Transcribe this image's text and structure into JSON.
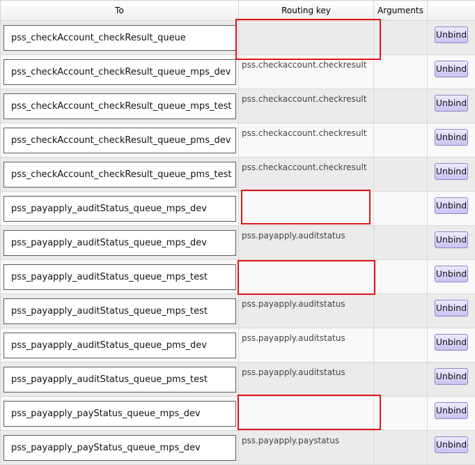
{
  "headers": {
    "to": "To",
    "routing_key": "Routing key",
    "arguments": "Arguments",
    "actions": ""
  },
  "unbind_label": "Unbind",
  "rows": [
    {
      "to": "pss_checkAccount_checkResult_queue",
      "routing_key": "",
      "arguments": ""
    },
    {
      "to": "pss_checkAccount_checkResult_queue_mps_dev",
      "routing_key": "pss.checkaccount.checkresult",
      "arguments": ""
    },
    {
      "to": "pss_checkAccount_checkResult_queue_mps_test",
      "routing_key": "pss.checkaccount.checkresult",
      "arguments": ""
    },
    {
      "to": "pss_checkAccount_checkResult_queue_pms_dev",
      "routing_key": "pss.checkaccount.checkresult",
      "arguments": ""
    },
    {
      "to": "pss_checkAccount_checkResult_queue_pms_test",
      "routing_key": "pss.checkaccount.checkresult",
      "arguments": ""
    },
    {
      "to": "pss_payapply_auditStatus_queue_mps_dev",
      "routing_key": "",
      "arguments": ""
    },
    {
      "to": "pss_payapply_auditStatus_queue_mps_dev",
      "routing_key": "pss.payapply.auditstatus",
      "arguments": ""
    },
    {
      "to": "pss_payapply_auditStatus_queue_mps_test",
      "routing_key": "",
      "arguments": ""
    },
    {
      "to": "pss_payapply_auditStatus_queue_mps_test",
      "routing_key": "pss.payapply.auditstatus",
      "arguments": ""
    },
    {
      "to": "pss_payapply_auditStatus_queue_pms_dev",
      "routing_key": "pss.payapply.auditstatus",
      "arguments": ""
    },
    {
      "to": "pss_payapply_auditStatus_queue_pms_test",
      "routing_key": "pss.payapply.auditstatus",
      "arguments": ""
    },
    {
      "to": "pss_payapply_payStatus_queue_mps_dev",
      "routing_key": "",
      "arguments": ""
    },
    {
      "to": "pss_payapply_payStatus_queue_mps_dev",
      "routing_key": "pss.payapply.paystatus",
      "arguments": ""
    }
  ]
}
